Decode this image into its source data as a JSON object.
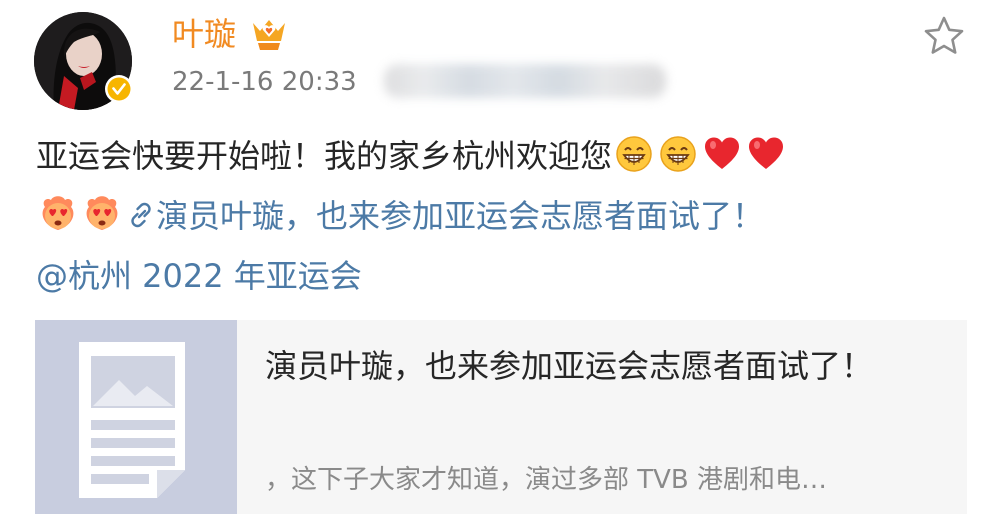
{
  "author": {
    "name": "叶璇",
    "verified": true
  },
  "meta": {
    "timestamp": "22-1-16 20:33"
  },
  "post": {
    "text_line1": "亚运会快要开始啦！我的家乡杭州欢迎您",
    "line1_emojis": [
      "grin-emoji",
      "grin-emoji",
      "red-heart-emoji",
      "red-heart-emoji"
    ],
    "line2_emojis": [
      "heart-eyes-emoji",
      "heart-eyes-emoji"
    ],
    "link_text": "演员叶璇，也来参加亚运会志愿者面试了！",
    "mention": "@杭州 2022 年亚运会"
  },
  "card": {
    "title": "演员叶璇，也来参加亚运会志愿者面试了！",
    "description": "，这下子大家才知道，演过多部 TVB 港剧和电…"
  },
  "colors": {
    "username": "#f18a21",
    "link": "#4c7aa6",
    "text": "#262626",
    "meta": "#7a7a7a",
    "verified_badge": "#f7b500",
    "card_bg": "#f6f6f6",
    "card_thumb_bg": "#c8cddf"
  }
}
